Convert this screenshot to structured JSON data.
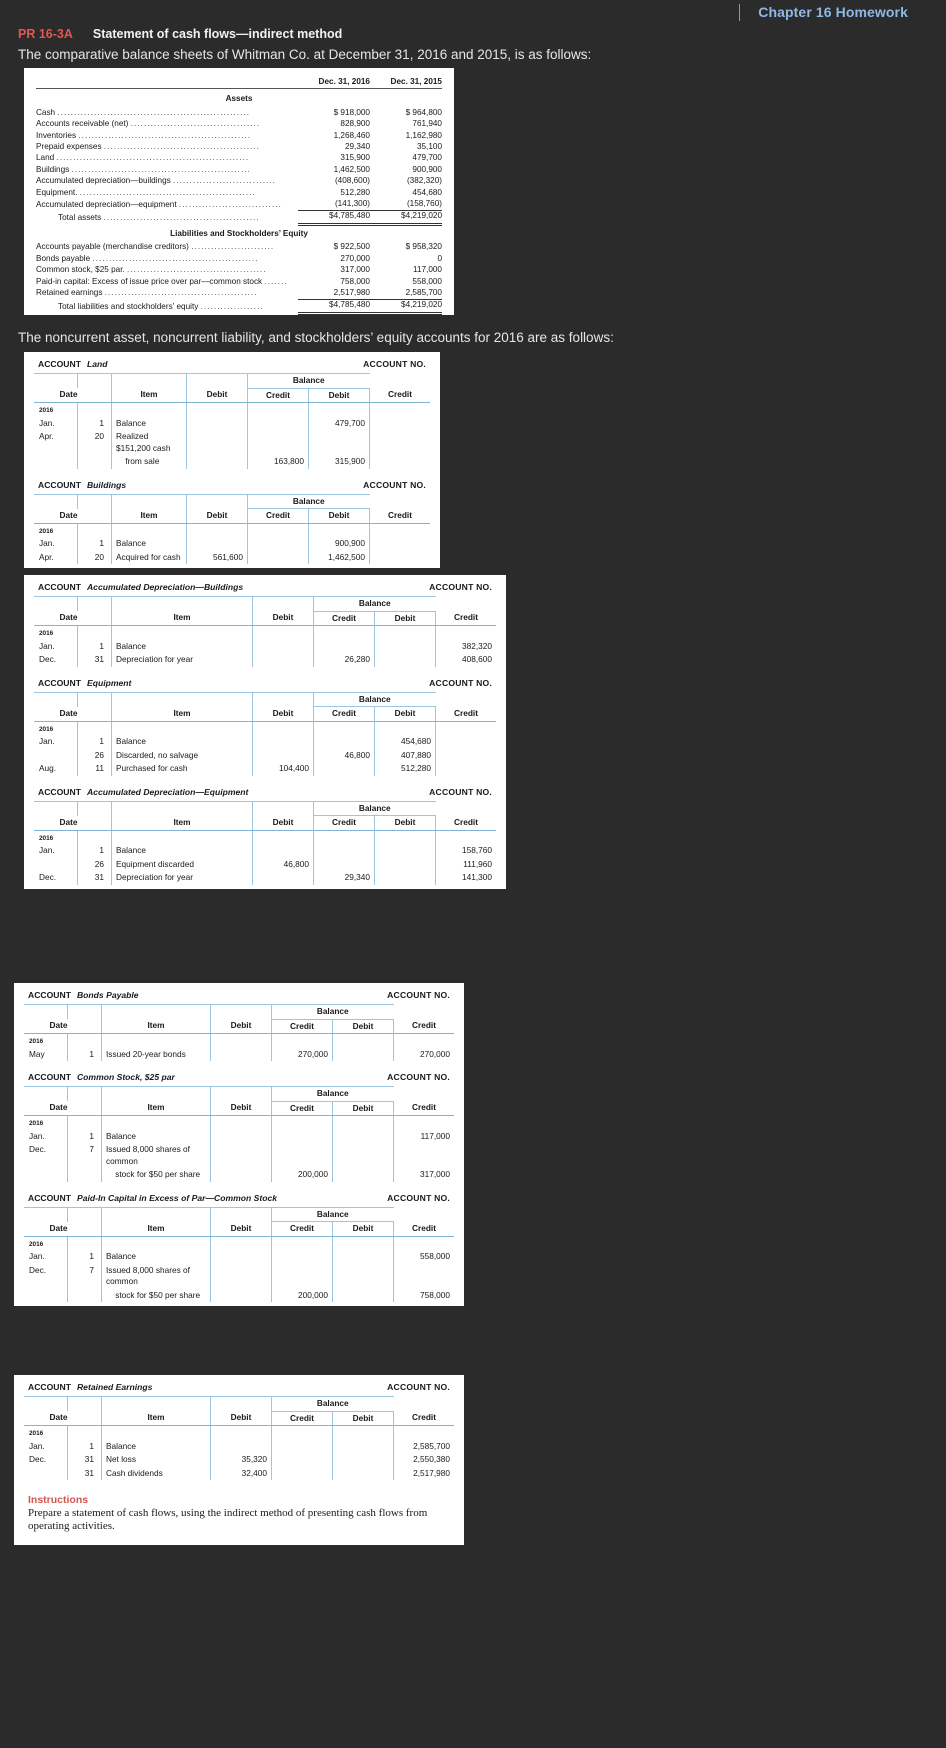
{
  "browser": {
    "tab_title": "Chapter 16 Homework"
  },
  "problem": {
    "number": "PR 16-3A",
    "title": "Statement of cash flows—indirect method",
    "intro": "The comparative balance sheets of Whitman Co. at December 31, 2016 and 2015, is as follows:",
    "intro2": "The noncurrent asset, noncurrent liability, and stockholders’ equity accounts for 2016 are as follows:"
  },
  "balance_sheet": {
    "col_headers": [
      "Dec. 31, 2016",
      "Dec. 31, 2015"
    ],
    "assets_heading": "Assets",
    "equity_heading": "Liabilities and Stockholders’ Equity",
    "assets": [
      {
        "label": "Cash",
        "c2016": "$  918,000",
        "c2015": "$  964,800"
      },
      {
        "label": "Accounts receivable (net)",
        "c2016": "828,900",
        "c2015": "761,940"
      },
      {
        "label": "Inventories",
        "c2016": "1,268,460",
        "c2015": "1,162,980"
      },
      {
        "label": "Prepaid expenses",
        "c2016": "29,340",
        "c2015": "35,100"
      },
      {
        "label": "Land",
        "c2016": "315,900",
        "c2015": "479,700"
      },
      {
        "label": "Buildings",
        "c2016": "1,462,500",
        "c2015": "900,900"
      },
      {
        "label": "Accumulated depreciation—buildings",
        "c2016": "(408,600)",
        "c2015": "(382,320)"
      },
      {
        "label": "Equipment.",
        "c2016": "512,280",
        "c2015": "454,680"
      },
      {
        "label": "Accumulated depreciation—equipment",
        "c2016": "(141,300)",
        "c2015": "(158,760)"
      }
    ],
    "assets_total": {
      "label": "Total assets",
      "c2016": "$4,785,480",
      "c2015": "$4,219,020"
    },
    "equity": [
      {
        "label": "Accounts payable (merchandise creditors)",
        "c2016": "$  922,500",
        "c2015": "$  958,320"
      },
      {
        "label": "Bonds payable",
        "c2016": "270,000",
        "c2015": "0"
      },
      {
        "label": "Common stock, $25 par.",
        "c2016": "317,000",
        "c2015": "117,000"
      },
      {
        "label": "Paid-in capital: Excess of issue price over par—common stock",
        "c2016": "758,000",
        "c2015": "558,000"
      },
      {
        "label": "Retained earnings",
        "c2016": "2,517,980",
        "c2015": "2,585,700"
      }
    ],
    "equity_total": {
      "label": "Total liabilities and stockholders’ equity",
      "c2016": "$4,785,480",
      "c2015": "$4,219,020"
    }
  },
  "ledger_labels": {
    "account_word": "ACCOUNT",
    "account_no": "ACCOUNT NO.",
    "date": "Date",
    "item": "Item",
    "debit": "Debit",
    "credit": "Credit",
    "balance": "Balance",
    "year": "2016"
  },
  "accounts": [
    {
      "name": "Land",
      "rows": [
        {
          "month": "Jan.",
          "day": "1",
          "item": "Balance",
          "debit": "",
          "credit": "",
          "bal_debit": "479,700",
          "bal_credit": ""
        },
        {
          "month": "Apr.",
          "day": "20",
          "item": "Realized $151,200 cash",
          "debit": "",
          "credit": "",
          "bal_debit": "",
          "bal_credit": ""
        },
        {
          "month": "",
          "day": "",
          "item": "from sale",
          "debit": "",
          "credit": "163,800",
          "bal_debit": "315,900",
          "bal_credit": "",
          "indent": true
        }
      ]
    },
    {
      "name": "Buildings",
      "rows": [
        {
          "month": "Jan.",
          "day": "1",
          "item": "Balance",
          "debit": "",
          "credit": "",
          "bal_debit": "900,900",
          "bal_credit": ""
        },
        {
          "month": "Apr.",
          "day": "20",
          "item": "Acquired for cash",
          "debit": "561,600",
          "credit": "",
          "bal_debit": "1,462,500",
          "bal_credit": ""
        }
      ]
    },
    {
      "name": "Accumulated Depreciation—Buildings",
      "rows": [
        {
          "month": "Jan.",
          "day": "1",
          "item": "Balance",
          "debit": "",
          "credit": "",
          "bal_debit": "",
          "bal_credit": "382,320"
        },
        {
          "month": "Dec.",
          "day": "31",
          "item": "Depreciation for year",
          "debit": "",
          "credit": "26,280",
          "bal_debit": "",
          "bal_credit": "408,600"
        }
      ]
    },
    {
      "name": "Equipment",
      "rows": [
        {
          "month": "Jan.",
          "day": "1",
          "item": "Balance",
          "debit": "",
          "credit": "",
          "bal_debit": "454,680",
          "bal_credit": ""
        },
        {
          "month": "",
          "day": "26",
          "item": "Discarded, no salvage",
          "debit": "",
          "credit": "46,800",
          "bal_debit": "407,880",
          "bal_credit": ""
        },
        {
          "month": "Aug.",
          "day": "11",
          "item": "Purchased for cash",
          "debit": "104,400",
          "credit": "",
          "bal_debit": "512,280",
          "bal_credit": ""
        }
      ]
    },
    {
      "name": "Accumulated Depreciation—Equipment",
      "rows": [
        {
          "month": "Jan.",
          "day": "1",
          "item": "Balance",
          "debit": "",
          "credit": "",
          "bal_debit": "",
          "bal_credit": "158,760"
        },
        {
          "month": "",
          "day": "26",
          "item": "Equipment discarded",
          "debit": "46,800",
          "credit": "",
          "bal_debit": "",
          "bal_credit": "111,960"
        },
        {
          "month": "Dec.",
          "day": "31",
          "item": "Depreciation for year",
          "debit": "",
          "credit": "29,340",
          "bal_debit": "",
          "bal_credit": "141,300"
        }
      ]
    },
    {
      "name": "Bonds Payable",
      "rows": [
        {
          "month": "May",
          "day": "1",
          "item": "Issued 20-year bonds",
          "debit": "",
          "credit": "270,000",
          "bal_debit": "",
          "bal_credit": "270,000"
        }
      ]
    },
    {
      "name": "Common Stock, $25 par",
      "rows": [
        {
          "month": "Jan.",
          "day": "1",
          "item": "Balance",
          "debit": "",
          "credit": "",
          "bal_debit": "",
          "bal_credit": "117,000"
        },
        {
          "month": "Dec.",
          "day": "7",
          "item": "Issued 8,000 shares of common",
          "debit": "",
          "credit": "",
          "bal_debit": "",
          "bal_credit": ""
        },
        {
          "month": "",
          "day": "",
          "item": "stock for $50 per share",
          "debit": "",
          "credit": "200,000",
          "bal_debit": "",
          "bal_credit": "317,000",
          "indent": true
        }
      ]
    },
    {
      "name": "Paid-In Capital in Excess of Par—Common Stock",
      "rows": [
        {
          "month": "Jan.",
          "day": "1",
          "item": "Balance",
          "debit": "",
          "credit": "",
          "bal_debit": "",
          "bal_credit": "558,000"
        },
        {
          "month": "Dec.",
          "day": "7",
          "item": "Issued 8,000 shares of common",
          "debit": "",
          "credit": "",
          "bal_debit": "",
          "bal_credit": ""
        },
        {
          "month": "",
          "day": "",
          "item": "stock for $50 per share",
          "debit": "",
          "credit": "200,000",
          "bal_debit": "",
          "bal_credit": "758,000",
          "indent": true
        }
      ]
    },
    {
      "name": "Retained Earnings",
      "rows": [
        {
          "month": "Jan.",
          "day": "1",
          "item": "Balance",
          "debit": "",
          "credit": "",
          "bal_debit": "",
          "bal_credit": "2,585,700"
        },
        {
          "month": "Dec.",
          "day": "31",
          "item": "Net loss",
          "debit": "35,320",
          "credit": "",
          "bal_debit": "",
          "bal_credit": "2,550,380"
        },
        {
          "month": "",
          "day": "31",
          "item": "Cash dividends",
          "debit": "32,400",
          "credit": "",
          "bal_debit": "",
          "bal_credit": "2,517,980"
        }
      ]
    }
  ],
  "instructions": {
    "title": "Instructions",
    "text": "Prepare a statement of cash flows, using the indirect method of presenting cash flows from operating activities."
  },
  "colors": {
    "accent_red": "#d4564e",
    "tab_blue": "#8fb8e8",
    "rule_blue": "#9fc6e0",
    "page_bg": "#2b2b2b"
  }
}
